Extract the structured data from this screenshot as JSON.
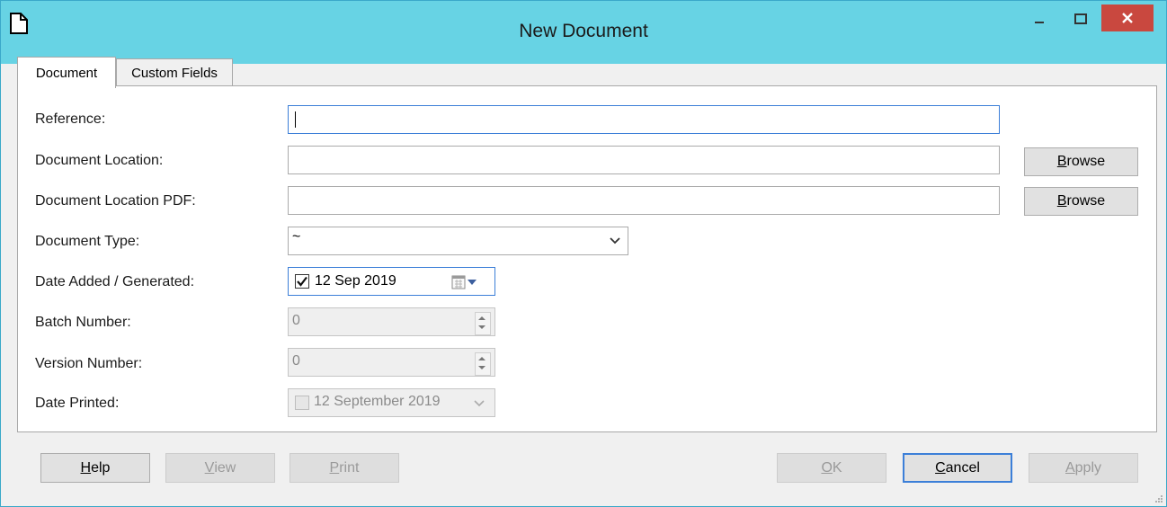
{
  "window": {
    "title": "New Document"
  },
  "tabs": [
    {
      "label": "Document",
      "active": true
    },
    {
      "label": "Custom Fields",
      "active": false
    }
  ],
  "form": {
    "reference": {
      "label": "Reference:",
      "value": ""
    },
    "document_location": {
      "label": "Document Location:",
      "value": "",
      "browse_label": "Browse",
      "browse_hotkey": "B",
      "browse_rest": "rowse"
    },
    "document_location_pdf": {
      "label": "Document Location PDF:",
      "value": "",
      "browse_label": "Browse",
      "browse_hotkey": "B",
      "browse_rest": "rowse"
    },
    "document_type": {
      "label": "Document Type:",
      "value": "~"
    },
    "date_added": {
      "label": "Date Added / Generated:",
      "checked": true,
      "value": "12 Sep 2019"
    },
    "batch_number": {
      "label": "Batch Number:",
      "value": "0"
    },
    "version_number": {
      "label": "Version Number:",
      "value": "0"
    },
    "date_printed": {
      "label": "Date Printed:",
      "checked": false,
      "value": "12 September 2019"
    }
  },
  "buttons": {
    "help": {
      "label": "Help",
      "hotkey": "H",
      "rest": "elp",
      "enabled": true
    },
    "view": {
      "label": "View",
      "hotkey": "V",
      "rest": "iew",
      "enabled": false
    },
    "print": {
      "label": "Print",
      "hotkey": "P",
      "rest": "rint",
      "enabled": false
    },
    "ok": {
      "label": "OK",
      "hotkey": "O",
      "rest": "K",
      "enabled": false
    },
    "cancel": {
      "label": "Cancel",
      "hotkey": "C",
      "rest": "ancel",
      "enabled": true
    },
    "apply": {
      "label": "Apply",
      "hotkey": "A",
      "rest": "pply",
      "enabled": false
    }
  },
  "icons": {
    "app": "document-icon",
    "minimize": "minimize-icon",
    "maximize": "maximize-icon",
    "close": "close-icon",
    "calendar": "calendar-icon",
    "dropdown": "chevron-down-icon"
  },
  "colors": {
    "titlebar": "#67d3e4",
    "close_button": "#c9483f",
    "focus_border": "#3c7fd8"
  }
}
